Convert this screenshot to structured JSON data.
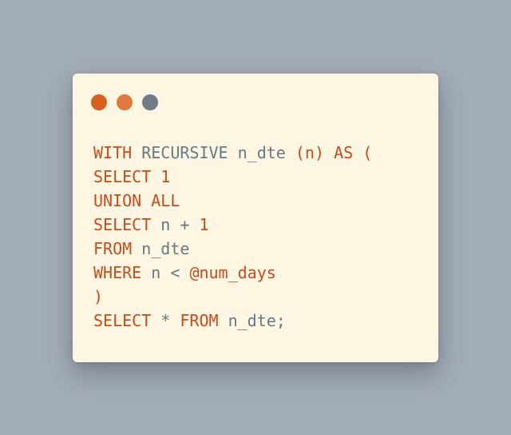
{
  "colors": {
    "background": "#a3adb8",
    "panel": "#fdf6e3",
    "keyword": "#cb4b16",
    "identifier": "#657b83",
    "dot_1": "#d95f1e",
    "dot_2": "#e0793b",
    "dot_3": "#6f7b86"
  },
  "window_controls": [
    {
      "name": "close-dot-icon"
    },
    {
      "name": "minimize-dot-icon"
    },
    {
      "name": "maximize-dot-icon"
    }
  ],
  "code": {
    "language": "sql",
    "lines": [
      [
        {
          "t": "WITH",
          "c": "kw"
        },
        {
          "t": " ",
          "c": "id"
        },
        {
          "t": "RECURSIVE",
          "c": "id"
        },
        {
          "t": " n_dte ",
          "c": "id"
        },
        {
          "t": "(n)",
          "c": "pn"
        },
        {
          "t": " ",
          "c": "id"
        },
        {
          "t": "AS",
          "c": "kw"
        },
        {
          "t": " (",
          "c": "pn"
        }
      ],
      [
        {
          "t": "SELECT",
          "c": "kw"
        },
        {
          "t": " ",
          "c": "id"
        },
        {
          "t": "1",
          "c": "kw"
        }
      ],
      [
        {
          "t": "UNION ALL",
          "c": "kw"
        }
      ],
      [
        {
          "t": "SELECT",
          "c": "kw"
        },
        {
          "t": " n + ",
          "c": "id"
        },
        {
          "t": "1",
          "c": "kw"
        }
      ],
      [
        {
          "t": "FROM",
          "c": "kw"
        },
        {
          "t": " n_dte",
          "c": "id"
        }
      ],
      [
        {
          "t": "WHERE",
          "c": "kw"
        },
        {
          "t": " n < ",
          "c": "id"
        },
        {
          "t": "@num_days",
          "c": "var"
        }
      ],
      [
        {
          "t": ")",
          "c": "pn"
        }
      ],
      [
        {
          "t": "SELECT",
          "c": "kw"
        },
        {
          "t": " * ",
          "c": "id"
        },
        {
          "t": "FROM",
          "c": "kw"
        },
        {
          "t": " n_dte;",
          "c": "id"
        }
      ]
    ]
  }
}
